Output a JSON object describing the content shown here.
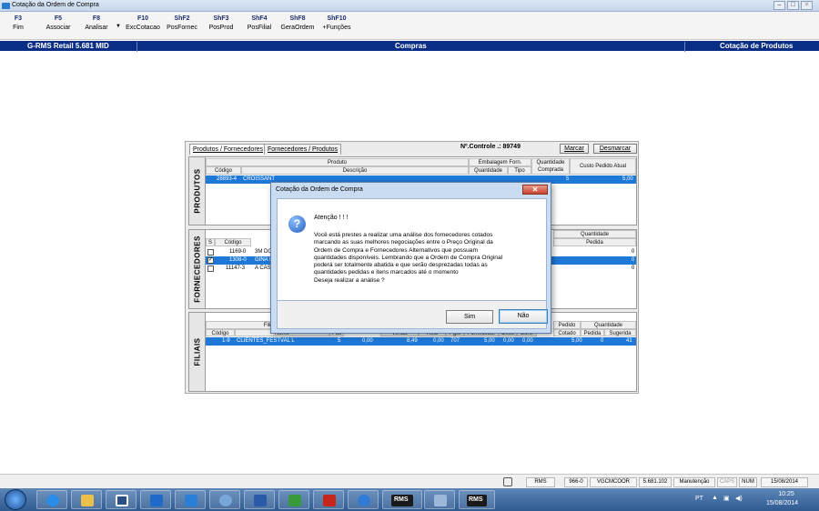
{
  "window": {
    "title": "Cotação da Ordem de Compra"
  },
  "toolbar": {
    "keys": [
      {
        "key": "F3",
        "label": "Fim"
      },
      {
        "key": "F5",
        "label": "Associar"
      },
      {
        "key": "F8",
        "label": "Analisar"
      },
      {
        "key": "F10",
        "label": "ExcCotacao"
      },
      {
        "key": "ShF2",
        "label": "PosFornec"
      },
      {
        "key": "ShF3",
        "label": "PosProd"
      },
      {
        "key": "ShF4",
        "label": "PosFilial"
      },
      {
        "key": "ShF8",
        "label": "GeraOrdem"
      },
      {
        "key": "ShF10",
        "label": "+Funções"
      }
    ]
  },
  "header": {
    "left": "G-RMS Retail 5.681 MID",
    "center": "Compras",
    "right": "Cotação de Produtos"
  },
  "panel": {
    "tabs": [
      "Produtos / Fornecedores",
      "Fornecedores / Produtos"
    ],
    "controle_label": "Nº.Controle .: 89749",
    "marcar": "Marcar",
    "desmarcar": "Desmarcar",
    "produtos": {
      "side": "PRODUTOS",
      "h_produto": "Produto",
      "h_codigo": "Código",
      "h_descricao": "Descrição",
      "h_embalagem": "Embalagem Forn.",
      "h_quantidade": "Quantidade",
      "h_tipo": "Tipo",
      "h_qtd_comprada": "Quantidade Comprada",
      "h_custo": "Custo Pedido Atual",
      "row": {
        "codigo": "28893-4",
        "descricao": "CROISSANT",
        "qtd": "5",
        "custo": "5,00"
      }
    },
    "fornecedores": {
      "side": "FORNECEDORES",
      "h_s": "S",
      "h_codigo": "Código",
      "h_quantidade": "Quantidade",
      "h_pedida": "Pedida",
      "rows": [
        {
          "codigo": "1169-0",
          "nome": "3M DO",
          "pedida": "0",
          "checked": false
        },
        {
          "codigo": "1308-0",
          "nome": "GINA I",
          "pedida": "0",
          "checked": true
        },
        {
          "codigo": "11147-3",
          "nome": "A CASA",
          "pedida": "0",
          "checked": false
        }
      ]
    },
    "filiais": {
      "side": "FILIAIS",
      "h_filial": "Filial",
      "h_codigo": "Código",
      "h_nome": "Nome",
      "h_pau": "Pau",
      "h_venda": "Venda",
      "h_real": "Real",
      "h_pgto": "Pgto",
      "h_fornecedor": "Fornecedor",
      "h_desc": "Desc",
      "h_bonif": "Bonif",
      "h_pedido": "Pedido",
      "h_cotado": "Cotado",
      "h_quantidade": "Quantidade",
      "h_pedida": "Pedida",
      "h_sugerida": "Sugerida",
      "row": {
        "codigo": "1-9",
        "nome": "CLIENTES_FESTVAL L",
        "pau": "5",
        "c1": "0,00",
        "venda": "8,49",
        "real": "0,00",
        "pgto": "707",
        "fornecedor": "5,00",
        "desc": "0,00",
        "bonif": "0,00",
        "cotado": "5,00",
        "pedida": "0",
        "sugerida": "41"
      }
    }
  },
  "dialog": {
    "title": "Cotação da Ordem de Compra",
    "heading": "Atenção ! ! !",
    "message_lines": [
      "Você está prestes a realizar uma análise dos fornecedores cotados",
      "marcando as suas melhores negociações entre o Preço Original da",
      "Ordem de Compra e Fornecedores Alternativos que possuam",
      "quantidades disponíveis. Lembrando que a Ordem de Compra Original",
      "poderá ser totalmente abatida e que serão desprezadas todas as",
      "quantidades pedidas e itens marcados até o momento",
      "Deseja realizar a análise ?"
    ],
    "yes": "Sim",
    "no": "Não"
  },
  "statusbar": [
    "RMS",
    "966-0",
    "VGCMCOOR",
    "5.681.102",
    "Manutenção",
    "CAPS",
    "NUM",
    "15/08/2014"
  ],
  "taskbar": {
    "lang": "PT",
    "time": "10:25",
    "date": "15/08/2014",
    "rms1": "RMS",
    "rms2": "RMS"
  },
  "colors": {
    "header_bg": "#0a2e86",
    "selection": "#1e78d7",
    "dialog_frame": "#c9dcf1"
  }
}
